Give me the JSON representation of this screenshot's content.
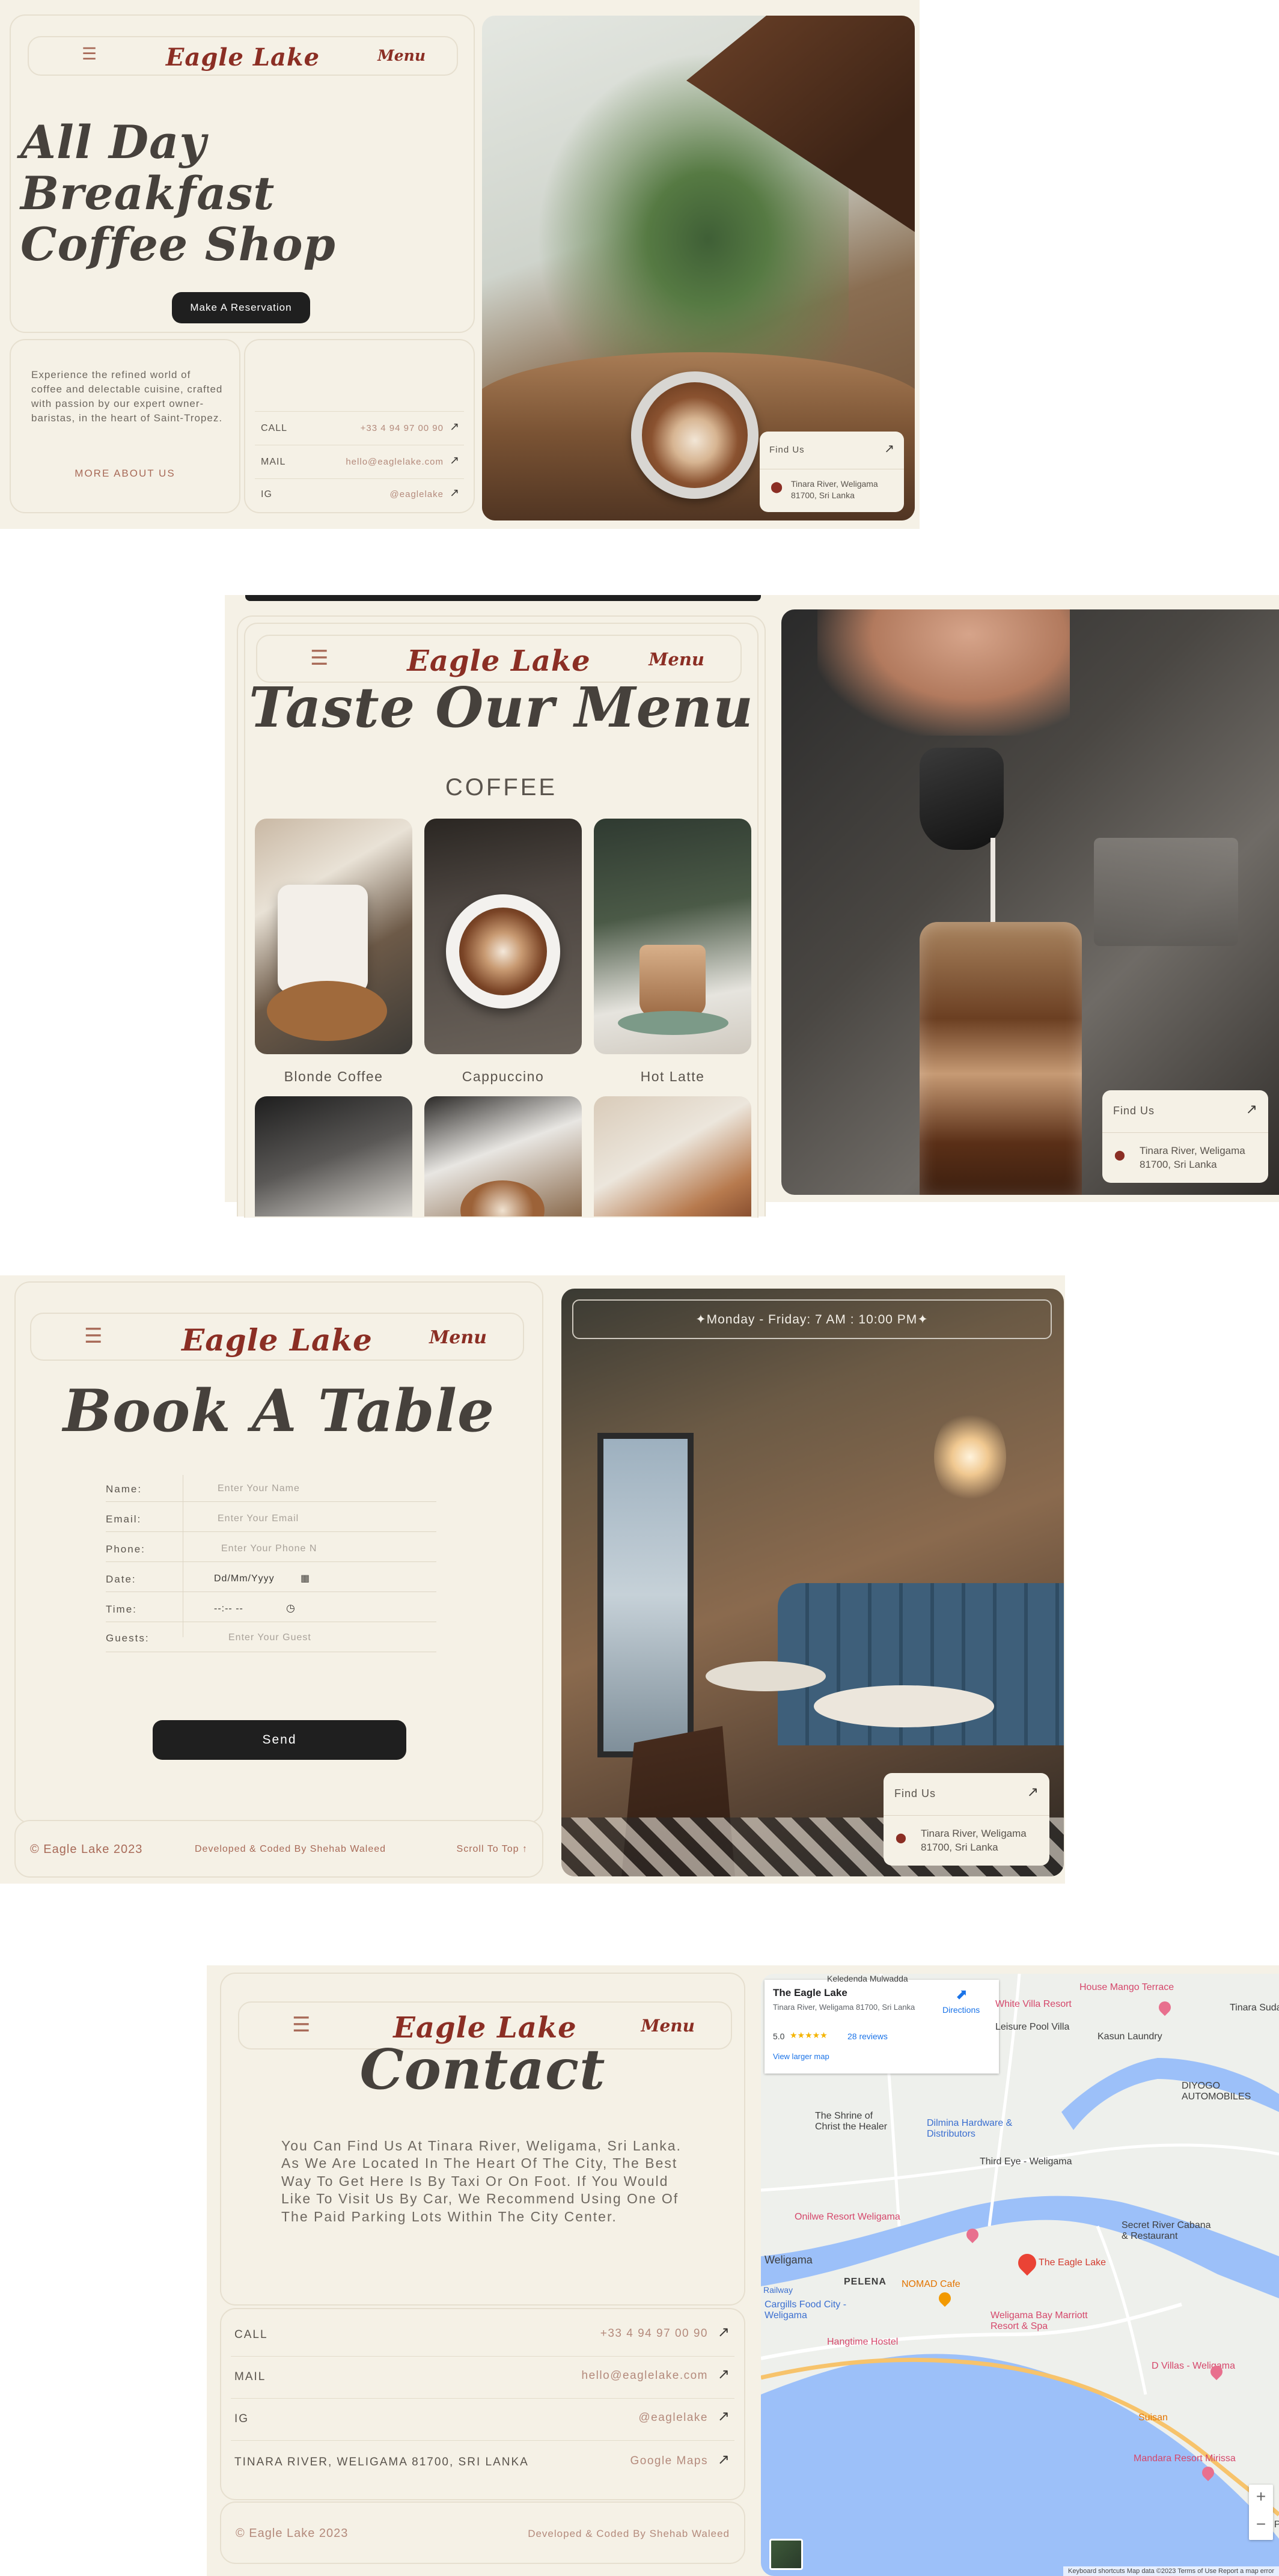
{
  "brand": {
    "logo": "Eagle Lake",
    "menu": "Menu",
    "hamburger": "☰"
  },
  "hero": {
    "title_line1": "All Day Breakfast",
    "title_line2": "Coffee Shop",
    "reservation_button": "Make A Reservation",
    "about_text": "Experience the refined world of coffee and delectable cuisine, crafted with passion by our expert owner-baristas, in the heart of Saint-Tropez.",
    "more_about": "MORE ABOUT US",
    "contacts": [
      {
        "label": "CALL",
        "value": "+33 4 94 97 00 90"
      },
      {
        "label": "MAIL",
        "value": "hello@eaglelake.com"
      },
      {
        "label": "IG",
        "value": "@eaglelake"
      }
    ]
  },
  "find_us": {
    "label": "Find Us",
    "address": "Tinara River, Weligama 81700, Sri Lanka"
  },
  "menu_section": {
    "title": "Taste Our Menu",
    "category": "COFFEE",
    "items": [
      {
        "name": "Blonde Coffee"
      },
      {
        "name": "Cappuccino"
      },
      {
        "name": "Hot Latte"
      }
    ]
  },
  "booking": {
    "title": "Book A Table",
    "hours": "✦Monday - Friday: 7 AM : 10:00 PM✦",
    "fields": [
      {
        "label": "Name:",
        "placeholder": "Enter Your Name"
      },
      {
        "label": "Email:",
        "placeholder": "Enter Your Email"
      },
      {
        "label": "Phone:",
        "placeholder": "Enter Your Phone N"
      },
      {
        "label": "Date:",
        "placeholder": "Dd/Mm/Yyyy"
      },
      {
        "label": "Time:",
        "placeholder": "--:-- --"
      },
      {
        "label": "Guests:",
        "placeholder": "Enter Your Guest"
      }
    ],
    "send": "Send"
  },
  "footer": {
    "copyright": "© Eagle Lake 2023",
    "credit": "Developed & Coded By Shehab Waleed",
    "scroll_top": "Scroll To Top ↑"
  },
  "contact": {
    "title": "Contact",
    "text": "You Can Find Us At Tinara River, Weligama, Sri Lanka. As We Are Located In The Heart Of The City, The Best Way To Get Here Is By Taxi Or On Foot. If You Would Like To Visit Us By Car, We Recommend Using One Of The Paid Parking Lots Within The City Center.",
    "rows": [
      {
        "label": "CALL",
        "value": "+33 4 94 97 00 90"
      },
      {
        "label": "MAIL",
        "value": "hello@eaglelake.com"
      },
      {
        "label": "IG",
        "value": "@eaglelake"
      },
      {
        "label": "TINARA RIVER, WELIGAMA 81700, SRI LANKA",
        "value": "Google Maps"
      }
    ]
  },
  "map": {
    "place_name": "The Eagle Lake",
    "place_address": "Tinara River, Weligama 81700, Sri Lanka",
    "rating": "5.0",
    "stars": "★★★★★",
    "reviews": "28 reviews",
    "directions": "Directions",
    "larger_map": "View larger map",
    "labels": [
      "House Mango Terrace",
      "White Villa Resort",
      "Tinara Sudarsha",
      "Leisure Pool Villa",
      "Kasun Laundry",
      "DIYOGO AUTOMOBILES",
      "The Shrine of Christ the Healer",
      "Dilmina Hardware & Distributors",
      "Third Eye - Weligama",
      "Onilwe Resort Weligama",
      "Secret River Cabana & Restaurant",
      "The Eagle Lake",
      "Weligama",
      "PELENA",
      "NOMAD Cafe",
      "Cargills Food City - Weligama",
      "Weligama Bay Marriott Resort & Spa",
      "Hangtime Hostel",
      "D Villas - Weligama",
      "Suisan",
      "Mandara Resort Mirissa",
      "Kada Po",
      "Railway",
      "Keledenda Mulwadda"
    ],
    "footer": "Keyboard shortcuts   Map data ©2023   Terms of Use   Report a map error",
    "zoom_in": "+",
    "zoom_out": "−"
  }
}
